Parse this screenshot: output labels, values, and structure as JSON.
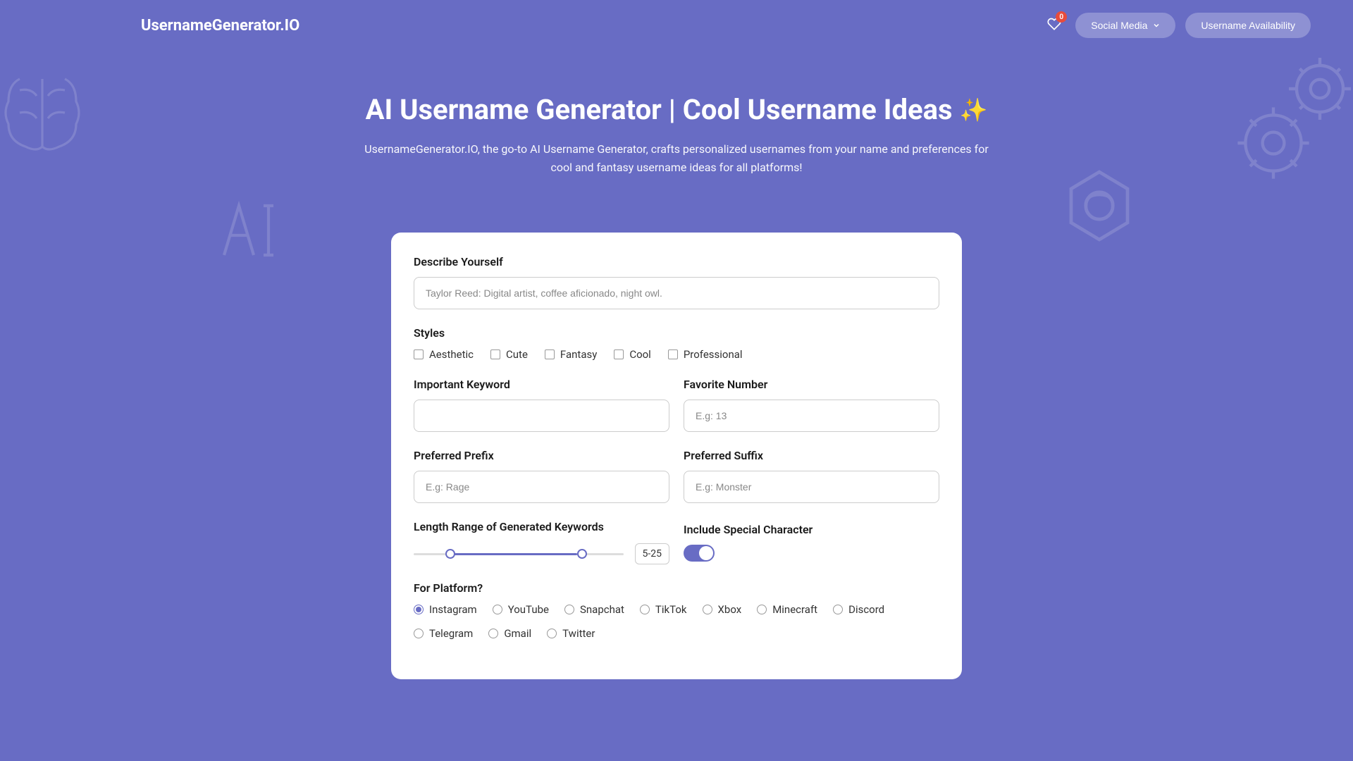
{
  "header": {
    "logo": "UsernameGenerator.IO",
    "badge_count": "0",
    "social_media_label": "Social Media",
    "availability_label": "Username Availability"
  },
  "hero": {
    "title": "AI Username Generator | Cool Username Ideas",
    "sparkle": "✨",
    "subtitle": "UsernameGenerator.IO, the go-to AI Username Generator, crafts personalized usernames from your name and preferences for cool and fantasy username ideas for all platforms!"
  },
  "form": {
    "describe_label": "Describe Yourself",
    "describe_placeholder": "Taylor Reed: Digital artist, coffee aficionado, night owl.",
    "styles_label": "Styles",
    "styles": [
      "Aesthetic",
      "Cute",
      "Fantasy",
      "Cool",
      "Professional"
    ],
    "keyword_label": "Important Keyword",
    "favorite_number_label": "Favorite Number",
    "favorite_number_placeholder": "E.g: 13",
    "prefix_label": "Preferred Prefix",
    "prefix_placeholder": "E.g: Rage",
    "suffix_label": "Preferred Suffix",
    "suffix_placeholder": "E.g: Monster",
    "length_label": "Length Range of Generated Keywords",
    "length_value": "5-25",
    "special_char_label": "Include Special Character",
    "platform_label": "For Platform?",
    "platforms": [
      "Instagram",
      "YouTube",
      "Snapchat",
      "TikTok",
      "Xbox",
      "Minecraft",
      "Discord",
      "Telegram",
      "Gmail",
      "Twitter"
    ],
    "selected_platform": "Instagram"
  }
}
